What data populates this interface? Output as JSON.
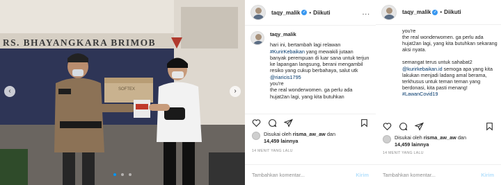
{
  "post": {
    "username": "taqy_malik",
    "separator": "•",
    "follow_status": "Diikuti",
    "more": "...",
    "caption": {
      "line1": "hari ini, bertambah lagi relawan",
      "mention1": "#KurirKebaikan",
      "line2": " yang mewakili jutaan banyak perempuan di luar sana untuk terjun ke lapangan langsung, berani mengambil resiko yang cukup berbahaya, salut utk ",
      "mention2": "@riaricis1795",
      "line3": "\nyou're\nthe real wonderwomen. ga perlu ada hujat2an lagi, yang kita butuhkan"
    },
    "likes": {
      "prefix": "Disukai oleh",
      "user": "risma_aw_aw",
      "and": "dan",
      "count": "14,459 lainnya"
    },
    "time": "14 MENIT YANG LALU",
    "comment_placeholder": "Tambahkan komentar...",
    "send_label": "Kirim"
  },
  "panel": {
    "username": "taqy_malik",
    "separator": "•",
    "follow_status": "Diikuti",
    "caption_part1": "you're\nthe real wonderwomen. ga perlu ada hujat2an lagi, yang kita butuhkan sekarang aksi nyata.\n\nsemangat terus untuk sahabat2 ",
    "mention": "@kurirkebaikan.id",
    "caption_part2": " semoga apa yang kita lakukan menjadi ladang amal berama, terkhusus untuk teman teman yang berdonasi, kita pasti menang! ",
    "hashtag": "#LawanCovid19",
    "likes": {
      "prefix": "Disukai oleh",
      "user": "risma_aw_aw",
      "and": "dan",
      "count": "14,459 lainnya"
    },
    "time": "14 MENIT YANG LALU",
    "comment_placeholder": "Tambahkan komentar...",
    "send_label": "Kirim"
  },
  "photo": {
    "building_sign": "RS. BHAYANGKARA BRIMOB",
    "box_label": "SOFTEX"
  },
  "colors": {
    "link": "#00376b",
    "verified": "#3897f0",
    "send": "#b2dffc",
    "carousel_active": "#0095f6"
  }
}
